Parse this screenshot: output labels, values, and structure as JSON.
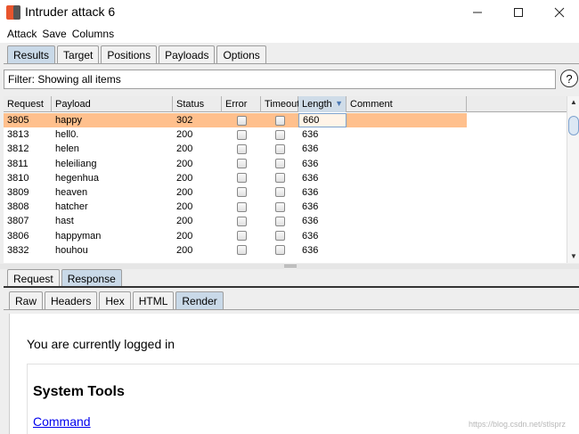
{
  "window": {
    "title": "Intruder attack 6"
  },
  "menu": [
    "Attack",
    "Save",
    "Columns"
  ],
  "tabs": [
    {
      "label": "Results",
      "active": true
    },
    {
      "label": "Target",
      "active": false
    },
    {
      "label": "Positions",
      "active": false
    },
    {
      "label": "Payloads",
      "active": false
    },
    {
      "label": "Options",
      "active": false
    }
  ],
  "filter": {
    "text": "Filter: Showing all items"
  },
  "help": {
    "label": "?"
  },
  "table": {
    "columns": [
      "Request",
      "Payload",
      "Status",
      "Error",
      "Timeout",
      "Length",
      "Comment"
    ],
    "sorted_column": "Length",
    "rows": [
      {
        "request": "3805",
        "payload": "happy",
        "status": "302",
        "length": "660",
        "selected": true
      },
      {
        "request": "3813",
        "payload": "hell0.",
        "status": "200",
        "length": "636",
        "selected": false
      },
      {
        "request": "3812",
        "payload": "helen",
        "status": "200",
        "length": "636",
        "selected": false
      },
      {
        "request": "3811",
        "payload": "heleiliang",
        "status": "200",
        "length": "636",
        "selected": false
      },
      {
        "request": "3810",
        "payload": "hegenhua",
        "status": "200",
        "length": "636",
        "selected": false
      },
      {
        "request": "3809",
        "payload": "heaven",
        "status": "200",
        "length": "636",
        "selected": false
      },
      {
        "request": "3808",
        "payload": "hatcher",
        "status": "200",
        "length": "636",
        "selected": false
      },
      {
        "request": "3807",
        "payload": "hast",
        "status": "200",
        "length": "636",
        "selected": false
      },
      {
        "request": "3806",
        "payload": "happyman",
        "status": "200",
        "length": "636",
        "selected": false
      },
      {
        "request": "3832",
        "payload": "houhou",
        "status": "200",
        "length": "636",
        "selected": false
      }
    ]
  },
  "req_tabs": [
    {
      "label": "Request",
      "active": false
    },
    {
      "label": "Response",
      "active": true
    }
  ],
  "view_tabs": [
    {
      "label": "Raw",
      "active": false
    },
    {
      "label": "Headers",
      "active": false
    },
    {
      "label": "Hex",
      "active": false
    },
    {
      "label": "HTML",
      "active": false
    },
    {
      "label": "Render",
      "active": true
    }
  ],
  "render": {
    "logged_in_text": "You are currently logged in",
    "heading": "System Tools",
    "link": "Command",
    "watermark": "https://blog.csdn.net/stlsprz"
  },
  "colors": {
    "selected_row": "#ffc08d",
    "active_tab": "#c9d9e8",
    "link": "#0000ee"
  }
}
